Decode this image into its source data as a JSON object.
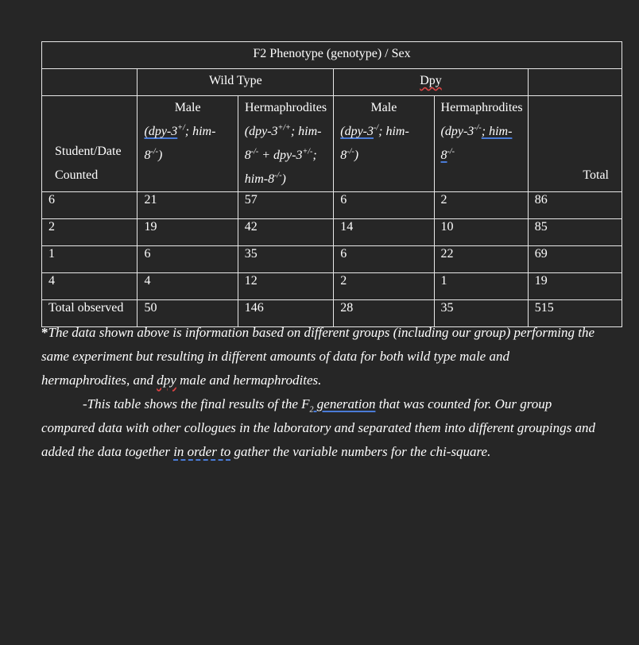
{
  "table": {
    "title": "F2 Phenotype (genotype) / Sex",
    "groups": [
      "Wild Type",
      "Dpy"
    ],
    "row_header_label_line1": "Student/Date",
    "row_header_label_line2": "Counted",
    "total_header": "Total",
    "columns": [
      {
        "label": "Male",
        "genotype_parts": [
          "(dpy-3",
          "+/",
          "; him-8",
          "-/-",
          ")"
        ]
      },
      {
        "label": "Hermaphrodites",
        "genotype_parts": [
          "(dpy-3",
          "+/+",
          "; him-8",
          "-/-",
          " + dpy-3",
          "+/-",
          "; him-8",
          "-/-",
          ")"
        ]
      },
      {
        "label": "Male",
        "genotype_parts": [
          "(dpy-3",
          "-/",
          "; him-8",
          "-/-",
          ")"
        ]
      },
      {
        "label": "Hermaphrodites",
        "genotype_parts": [
          "(dpy-3",
          "-/-",
          "; him-8",
          "-/-",
          ""
        ]
      }
    ],
    "rows": [
      {
        "student": "6",
        "wt_male": "21",
        "wt_herm": "57",
        "dpy_male": "6",
        "dpy_herm": "2",
        "total": "86"
      },
      {
        "student": "2",
        "wt_male": "19",
        "wt_herm": "42",
        "dpy_male": "14",
        "dpy_herm": "10",
        "total": "85"
      },
      {
        "student": "1",
        "wt_male": "6",
        "wt_herm": "35",
        "dpy_male": "6",
        "dpy_herm": "22",
        "total": "69"
      },
      {
        "student": "4",
        "wt_male": "4",
        "wt_herm": "12",
        "dpy_male": "2",
        "dpy_herm": "1",
        "total": "19"
      },
      {
        "student": "Total observed",
        "wt_male": "50",
        "wt_herm": "146",
        "dpy_male": "28",
        "dpy_herm": "35",
        "total": "515"
      }
    ]
  },
  "notes": {
    "note1_prefix": "*",
    "note1_a": "The data shown above is information based on different groups (including our group) performing the same experiment but resulting in different amounts of data for both wild type male and hermaphrodites, and ",
    "note1_dpy": "dpy",
    "note1_b": " male and hermaphrodites.",
    "note2_a": "-This table shows the final results of the F",
    "note2_sub": "2",
    "note2_gen": " generation",
    "note2_b": " that was counted for. Our group compared data with other collogues in the laboratory and separated them into different groupings and added the data together ",
    "note2_inorder": "in order to",
    "note2_c": " gather the variable numbers for the chi-square."
  }
}
